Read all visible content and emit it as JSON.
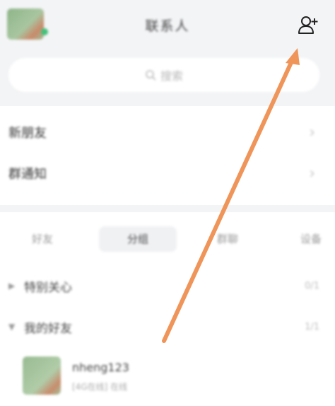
{
  "header": {
    "title": "联系人",
    "add_icon": "add-contact-icon"
  },
  "search": {
    "placeholder": "搜索",
    "icon": "search-icon"
  },
  "menu": {
    "items": [
      {
        "label": "新朋友"
      },
      {
        "label": "群通知"
      }
    ]
  },
  "tabs": [
    {
      "label": "好友"
    },
    {
      "label": "分组",
      "active": true
    },
    {
      "label": "群聊"
    },
    {
      "label": "设备"
    }
  ],
  "groups": [
    {
      "name": "特别关心",
      "count": "0/1"
    },
    {
      "name": "我的好友",
      "count": "1/1"
    }
  ],
  "contact": {
    "name": "nheng123",
    "status": "[4G在线] 在线"
  },
  "colors": {
    "annotation_arrow": "#f0955a",
    "background": "#f3f4f6"
  }
}
